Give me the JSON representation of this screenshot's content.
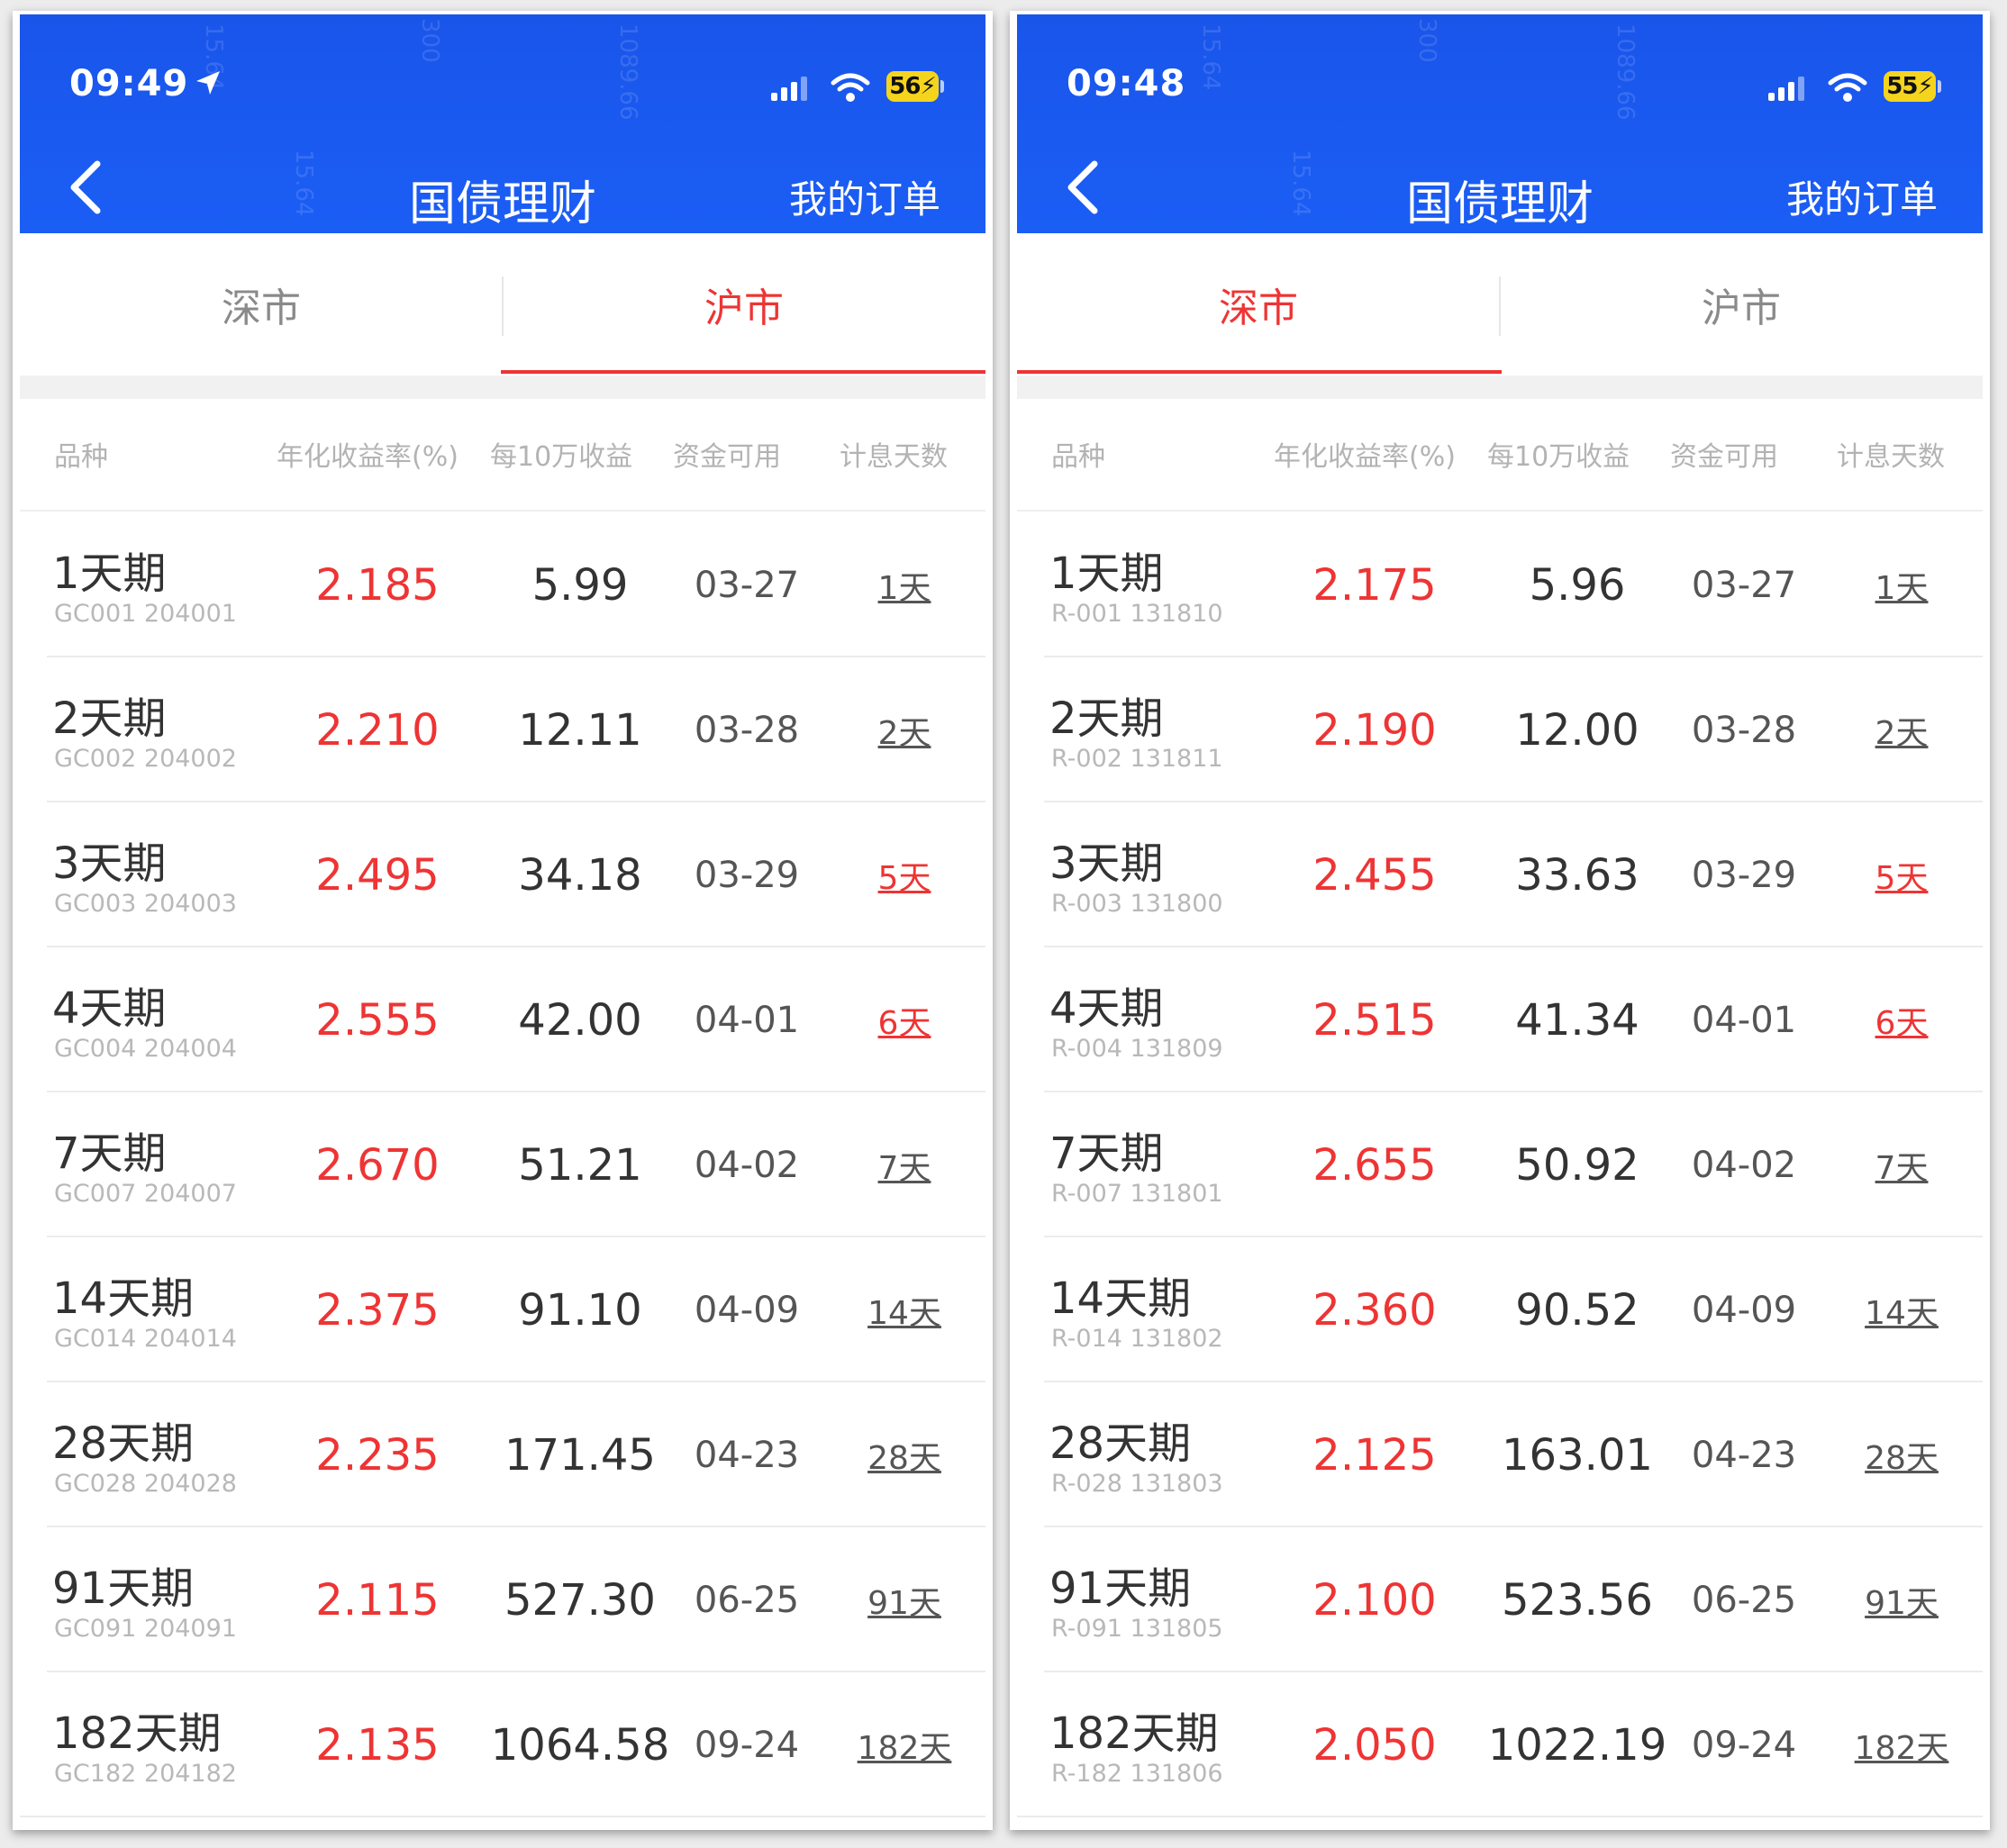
{
  "panels": [
    {
      "status": {
        "time": "09:49",
        "battery": "56",
        "location_icon": "location-arrow-icon"
      },
      "nav": {
        "title": "国债理财",
        "right_link": "我的订单",
        "back_icon": "chevron-left-icon"
      },
      "tabs": [
        {
          "label": "深市",
          "active": false
        },
        {
          "label": "沪市",
          "active": true
        }
      ],
      "columns": [
        "品种",
        "年化收益率(%)",
        "每10万收益",
        "资金可用",
        "计息天数"
      ],
      "rows": [
        {
          "name": "1天期",
          "code": "GC001 204001",
          "rate": "2.185",
          "gain": "5.99",
          "available": "03-27",
          "days": "1天",
          "days_highlight": false
        },
        {
          "name": "2天期",
          "code": "GC002 204002",
          "rate": "2.210",
          "gain": "12.11",
          "available": "03-28",
          "days": "2天",
          "days_highlight": false
        },
        {
          "name": "3天期",
          "code": "GC003 204003",
          "rate": "2.495",
          "gain": "34.18",
          "available": "03-29",
          "days": "5天",
          "days_highlight": true
        },
        {
          "name": "4天期",
          "code": "GC004 204004",
          "rate": "2.555",
          "gain": "42.00",
          "available": "04-01",
          "days": "6天",
          "days_highlight": true
        },
        {
          "name": "7天期",
          "code": "GC007 204007",
          "rate": "2.670",
          "gain": "51.21",
          "available": "04-02",
          "days": "7天",
          "days_highlight": false
        },
        {
          "name": "14天期",
          "code": "GC014 204014",
          "rate": "2.375",
          "gain": "91.10",
          "available": "04-09",
          "days": "14天",
          "days_highlight": false
        },
        {
          "name": "28天期",
          "code": "GC028 204028",
          "rate": "2.235",
          "gain": "171.45",
          "available": "04-23",
          "days": "28天",
          "days_highlight": false
        },
        {
          "name": "91天期",
          "code": "GC091 204091",
          "rate": "2.115",
          "gain": "527.30",
          "available": "06-25",
          "days": "91天",
          "days_highlight": false
        },
        {
          "name": "182天期",
          "code": "GC182 204182",
          "rate": "2.135",
          "gain": "1064.58",
          "available": "09-24",
          "days": "182天",
          "days_highlight": false
        }
      ]
    },
    {
      "status": {
        "time": "09:48",
        "battery": "55",
        "location_icon": ""
      },
      "nav": {
        "title": "国债理财",
        "right_link": "我的订单",
        "back_icon": "chevron-left-icon"
      },
      "tabs": [
        {
          "label": "深市",
          "active": true
        },
        {
          "label": "沪市",
          "active": false
        }
      ],
      "columns": [
        "品种",
        "年化收益率(%)",
        "每10万收益",
        "资金可用",
        "计息天数"
      ],
      "rows": [
        {
          "name": "1天期",
          "code": "R-001 131810",
          "rate": "2.175",
          "gain": "5.96",
          "available": "03-27",
          "days": "1天",
          "days_highlight": false
        },
        {
          "name": "2天期",
          "code": "R-002 131811",
          "rate": "2.190",
          "gain": "12.00",
          "available": "03-28",
          "days": "2天",
          "days_highlight": false
        },
        {
          "name": "3天期",
          "code": "R-003 131800",
          "rate": "2.455",
          "gain": "33.63",
          "available": "03-29",
          "days": "5天",
          "days_highlight": true
        },
        {
          "name": "4天期",
          "code": "R-004 131809",
          "rate": "2.515",
          "gain": "41.34",
          "available": "04-01",
          "days": "6天",
          "days_highlight": true
        },
        {
          "name": "7天期",
          "code": "R-007 131801",
          "rate": "2.655",
          "gain": "50.92",
          "available": "04-02",
          "days": "7天",
          "days_highlight": false
        },
        {
          "name": "14天期",
          "code": "R-014 131802",
          "rate": "2.360",
          "gain": "90.52",
          "available": "04-09",
          "days": "14天",
          "days_highlight": false
        },
        {
          "name": "28天期",
          "code": "R-028 131803",
          "rate": "2.125",
          "gain": "163.01",
          "available": "04-23",
          "days": "28天",
          "days_highlight": false
        },
        {
          "name": "91天期",
          "code": "R-091 131805",
          "rate": "2.100",
          "gain": "523.56",
          "available": "06-25",
          "days": "91天",
          "days_highlight": false
        },
        {
          "name": "182天期",
          "code": "R-182 131806",
          "rate": "2.050",
          "gain": "1022.19",
          "available": "09-24",
          "days": "182天",
          "days_highlight": false
        }
      ]
    }
  ],
  "colors": {
    "brand_blue": "#1b5ef5",
    "accent_red": "#ee3434",
    "battery_yellow": "#f5d41e"
  }
}
